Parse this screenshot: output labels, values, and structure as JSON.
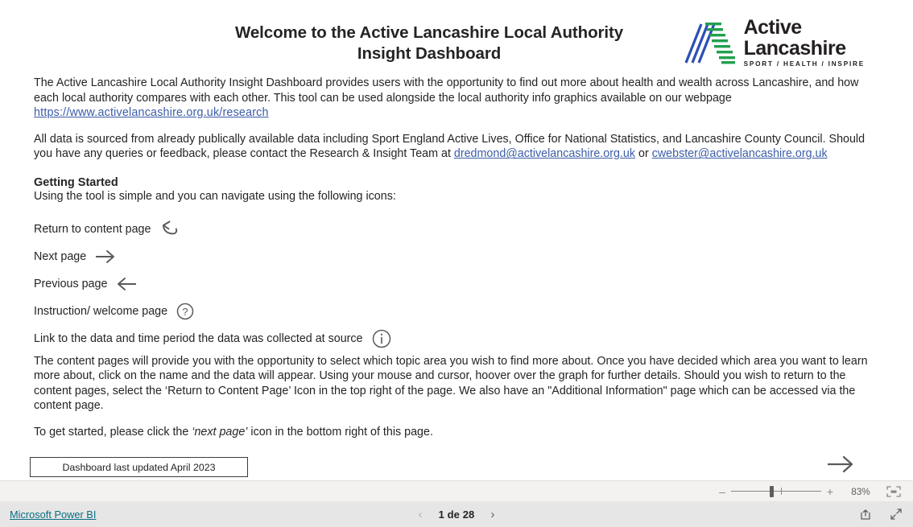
{
  "report": {
    "title_line_1": "Welcome to the Active Lancashire Local Authority",
    "title_line_2": "Insight Dashboard",
    "logo": {
      "word_1": "Active",
      "word_2": "Lancashire",
      "tagline": "SPORT / HEALTH / INSPIRE",
      "mark_icon": "active-lancashire-logo-icon",
      "blue": "#2b4fb5",
      "green": "#22a04f"
    },
    "intro": {
      "part_1": "The Active Lancashire Local Authority Insight Dashboard provides users with the opportunity to find out more about health and wealth across Lancashire, and how each local authority compares with each other. This tool can be used alongside the local authority info graphics available on our webpage ",
      "link_text": "https://www.activelancashire.org.uk/research"
    },
    "sources": {
      "part_1": "All data is sourced from already publically available data including Sport England Active Lives, Office for National Statistics, and Lancashire County Council. Should you have any queries or feedback, please contact the Research & Insight Team at ",
      "email_1": "dredmond@activelancashire.org.uk",
      "part_2": " or ",
      "email_2": "cwebster@activelancashire.org.uk"
    },
    "getting_started_heading": "Getting Started",
    "getting_started_lead": "Using the tool is simple and you can navigate using the following icons:",
    "legend": [
      {
        "label": "Return to content page",
        "icon": "return-curved-arrow-icon"
      },
      {
        "label": "Next page",
        "icon": "arrow-right-icon"
      },
      {
        "label": "Previous page",
        "icon": "arrow-left-icon"
      },
      {
        "label": "Instruction/ welcome page",
        "icon": "question-mark-circle-icon"
      },
      {
        "label": "Link to the data and time period the data was collected at source",
        "icon": "info-circle-icon"
      }
    ],
    "closing_paragraph": "The content pages will provide you with the opportunity to select which topic area you wish to find more about. Once you have decided which area you want to learn more about, click on the name and the data will appear. Using your mouse and cursor, hoover over the graph for further details. Should you wish to return to the content pages, select the ‘Return to Content Page’ Icon in the top right of the page. We also have an \"Additional Information\" page which can be accessed via the content page.",
    "get_started": {
      "before": "To get started, please click the ",
      "emphasis": "‘next page’",
      "after": " icon in the bottom right of this page."
    },
    "last_updated": "Dashboard last updated April 2023",
    "canvas_next_icon": "arrow-right-icon"
  },
  "statusbar": {
    "zoom_out_label": "–",
    "zoom_in_label": "+",
    "zoom_value": "83%",
    "fit_icon": "fit-to-page-icon"
  },
  "appbar": {
    "brand_link": "Microsoft Power BI",
    "prev_icon": "chevron-left-icon",
    "next_icon": "chevron-right-icon",
    "page_label": "1 de 28",
    "share_icon": "share-icon",
    "fullscreen_icon": "fullscreen-icon"
  }
}
